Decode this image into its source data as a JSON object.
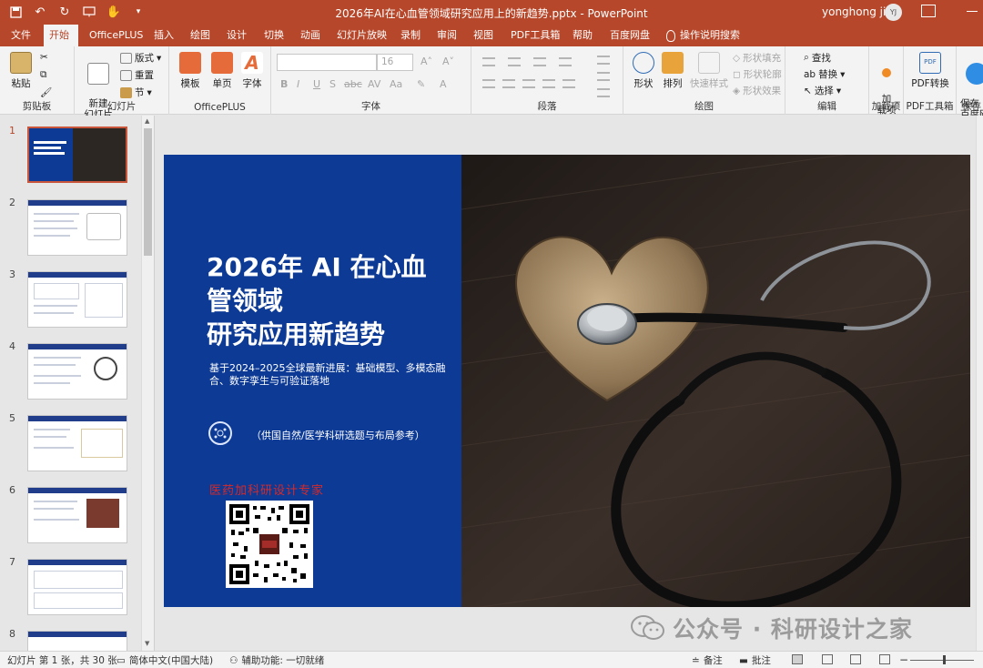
{
  "title_bar": {
    "document_title": "2026年AI在心血管领域研究应用上的新趋势.pptx  -  PowerPoint",
    "user_name": "yonghong jin",
    "user_initials": "YJ"
  },
  "tabs": [
    {
      "label": "文件",
      "active": false
    },
    {
      "label": "开始",
      "active": true
    },
    {
      "label": "OfficePLUS",
      "active": false
    },
    {
      "label": "插入",
      "active": false
    },
    {
      "label": "绘图",
      "active": false
    },
    {
      "label": "设计",
      "active": false
    },
    {
      "label": "切换",
      "active": false
    },
    {
      "label": "动画",
      "active": false
    },
    {
      "label": "幻灯片放映",
      "active": false
    },
    {
      "label": "录制",
      "active": false
    },
    {
      "label": "审阅",
      "active": false
    },
    {
      "label": "视图",
      "active": false
    },
    {
      "label": "PDF工具箱",
      "active": false
    },
    {
      "label": "帮助",
      "active": false
    },
    {
      "label": "百度网盘",
      "active": false
    }
  ],
  "help_search": "操作说明搜索",
  "ribbon": {
    "clipboard": {
      "label": "剪贴板",
      "paste": "粘贴"
    },
    "slides": {
      "label": "幻灯片",
      "new_slide": "新建\n幻灯片",
      "layout": "版式",
      "reset": "重置",
      "section": "节"
    },
    "officeplus": {
      "label": "OfficePLUS",
      "template": "模板",
      "single_page": "单页",
      "font": "字体"
    },
    "font": {
      "label": "字体",
      "size": "16"
    },
    "paragraph": {
      "label": "段落"
    },
    "drawing": {
      "label": "绘图",
      "shapes": "形状",
      "arrange": "排列",
      "quick_styles": "快速样式",
      "shape_fill": "形状填充",
      "shape_outline": "形状轮廓",
      "shape_effects": "形状效果"
    },
    "editing": {
      "label": "编辑",
      "find": "查找",
      "replace": "替换",
      "select": "选择"
    },
    "addins": {
      "label": "加载项",
      "addin": "加\n载项"
    },
    "pdf_tools": {
      "label": "PDF工具箱",
      "pdf_convert": "PDF转换"
    },
    "save": {
      "label": "保存",
      "save_to_baidu": "保存\n百度网"
    }
  },
  "thumbnails": [
    {
      "number": "1",
      "active": true
    },
    {
      "number": "2",
      "active": false
    },
    {
      "number": "3",
      "active": false
    },
    {
      "number": "4",
      "active": false
    },
    {
      "number": "5",
      "active": false
    },
    {
      "number": "6",
      "active": false
    },
    {
      "number": "7",
      "active": false
    },
    {
      "number": "8",
      "active": false
    }
  ],
  "slide": {
    "title": "2026年 AI 在心血\n管领域\n研究应用新趋势",
    "subtitle": "基于2024–2025全球最新进展：基础模型、多模态融合、数字孪生与可验证落地",
    "note": "（供国自然/医学科研选题与布局参考）",
    "expert": "医药加科研设计专家"
  },
  "watermark": {
    "text": "公众号 · 科研设计之家"
  },
  "status_bar": {
    "slide_count": "幻灯片 第 1 张，共 30 张",
    "language": "简体中文(中国大陆)",
    "accessibility": "辅助功能: 一切就绪",
    "notes": "备注",
    "comments": "批注"
  },
  "colors": {
    "accent": "#b7472a",
    "slide_blue": "#0d3a95",
    "expert_red": "#d42a2a"
  }
}
